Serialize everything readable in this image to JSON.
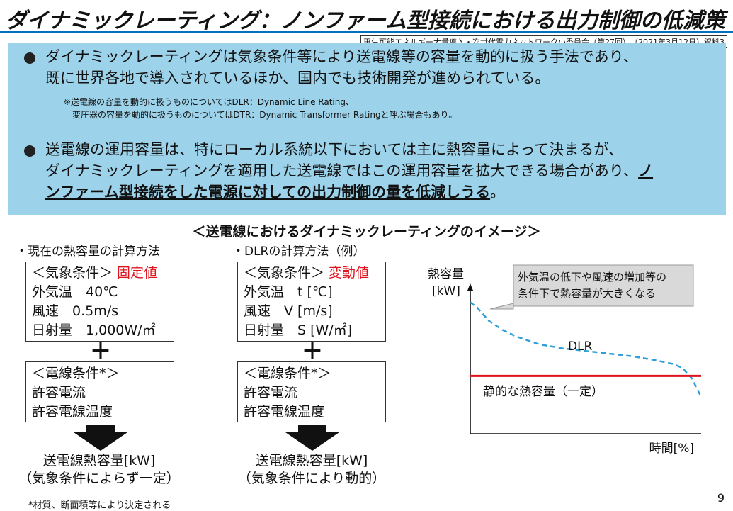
{
  "title": "ダイナミックレーティング：ノンファーム型接続における出力制御の低減策",
  "source": "再生可能エネルギー大量導入・次世代電力ネットワーク小委員会（第27回）　（2021年3月12日）資料3",
  "summary": {
    "bullet1_line1": "ダイナミックレーティングは気象条件等により送電線等の容量を動的に扱う手法であり、",
    "bullet1_line2": "既に世界各地で導入されているほか、国内でも技術開発が進められている。",
    "note_line1": "※送電線の容量を動的に扱うものについてはDLR：Dynamic Line Rating、",
    "note_line2": "変圧器の容量を動的に扱うものについてはDTR：Dynamic Transformer Ratingと呼ぶ場合もあり。",
    "bullet2_line1": "送電線の運用容量は、特にローカル系統以下においては主に熱容量によって決まるが、",
    "bullet2_line2a": "ダイナミックレーティングを適用した送電線ではこの運用容量を拡大できる場合があり、",
    "bullet2_line2b": "ノ",
    "bullet2_line3": "ンファーム型接続をした電源に対しての出力制御の量を低減しうる",
    "bullet2_line3_end": "。"
  },
  "diagram_heading": "＜送電線におけるダイナミックレーティングのイメージ＞",
  "current_method": {
    "label": "・現在の熱容量の計算方法",
    "weather_title": "＜気象条件＞",
    "weather_tag": "固定値",
    "temp": "外気温　40℃",
    "wind": "風速　0.5m/s",
    "solar": "日射量　1,000W/㎡",
    "plus": "＋",
    "line_title": "＜電線条件*＞",
    "current": "許容電流",
    "wire_temp": "許容電線温度",
    "result_line1": "送電線熱容量[kW]",
    "result_line2": "（気象条件によらず一定）"
  },
  "dlr_method": {
    "label": "・DLRの計算方法（例）",
    "weather_title": "＜気象条件＞",
    "weather_tag": "変動値",
    "temp": "外気温　t [℃]",
    "wind": "風速　V [m/s]",
    "solar": "日射量　S [W/㎡]",
    "plus": "＋",
    "line_title": "＜電線条件*＞",
    "current": "許容電流",
    "wire_temp": "許容電線温度",
    "result_line1": "送電線熱容量[kW]",
    "result_line2": "（気象条件により動的）"
  },
  "chart_data": {
    "type": "line",
    "ylabel_line1": "熱容量",
    "ylabel_line2": "[kW]",
    "xlabel": "時間[%]",
    "callout_line1": "外気温の低下や風速の増加等の",
    "callout_line2": "条件下で熱容量が大きくなる",
    "series": [
      {
        "name": "DLR",
        "color": "#2e9fd9",
        "style": "dashed",
        "x": [
          0,
          3,
          8,
          14,
          20,
          30,
          40,
          50,
          60,
          70,
          80,
          88,
          92,
          96,
          100
        ],
        "y": [
          100,
          96,
          86,
          79,
          74,
          68,
          65,
          63,
          61,
          59,
          56,
          53,
          50,
          42,
          28
        ]
      },
      {
        "name": "静的な熱容量（一定）",
        "color": "#e0141e",
        "style": "solid",
        "x": [
          0,
          100
        ],
        "y": [
          44,
          44
        ]
      }
    ],
    "xlim": [
      0,
      100
    ],
    "ylim": [
      0,
      110
    ]
  },
  "footnote": "*材質、断面積等により決定される",
  "page_number": "9",
  "colors": {
    "accent_blue": "#0070c0",
    "box_bg": "#9dd3ea",
    "red": "#e0141e",
    "dlr_blue": "#2e9fd9"
  }
}
